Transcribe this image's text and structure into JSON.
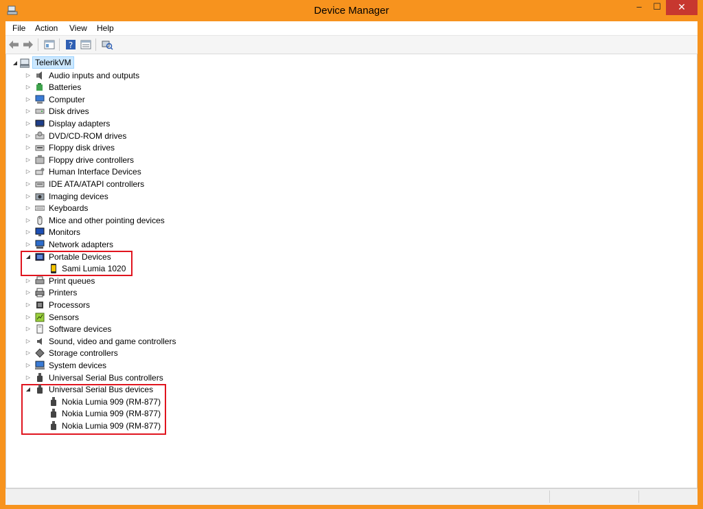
{
  "window": {
    "title": "Device Manager",
    "minimize": "–",
    "maximize": "☐",
    "close": "✕",
    "icon": "device-manager-icon"
  },
  "menu": [
    "File",
    "Action",
    "View",
    "Help"
  ],
  "toolbar": [
    "back-arrow-icon",
    "forward-arrow-icon",
    "show-hide-console-tree-icon",
    "help-icon",
    "properties-icon",
    "scan-hardware-icon"
  ],
  "tree": {
    "root": "TelerikVM",
    "categories": [
      {
        "label": "Audio inputs and outputs",
        "icon": "speaker-icon",
        "expanded": false
      },
      {
        "label": "Batteries",
        "icon": "battery-icon",
        "expanded": false
      },
      {
        "label": "Computer",
        "icon": "computer-icon",
        "expanded": false
      },
      {
        "label": "Disk drives",
        "icon": "disk-drive-icon",
        "expanded": false
      },
      {
        "label": "Display adapters",
        "icon": "display-adapter-icon",
        "expanded": false
      },
      {
        "label": "DVD/CD-ROM drives",
        "icon": "dvd-drive-icon",
        "expanded": false
      },
      {
        "label": "Floppy disk drives",
        "icon": "floppy-disk-icon",
        "expanded": false
      },
      {
        "label": "Floppy drive controllers",
        "icon": "floppy-controller-icon",
        "expanded": false
      },
      {
        "label": "Human Interface Devices",
        "icon": "hid-icon",
        "expanded": false
      },
      {
        "label": "IDE ATA/ATAPI controllers",
        "icon": "ide-controller-icon",
        "expanded": false
      },
      {
        "label": "Imaging devices",
        "icon": "camera-icon",
        "expanded": false
      },
      {
        "label": "Keyboards",
        "icon": "keyboard-icon",
        "expanded": false
      },
      {
        "label": "Mice and other pointing devices",
        "icon": "mouse-icon",
        "expanded": false
      },
      {
        "label": "Monitors",
        "icon": "monitor-icon",
        "expanded": false
      },
      {
        "label": "Network adapters",
        "icon": "network-adapter-icon",
        "expanded": false
      },
      {
        "label": "Portable Devices",
        "icon": "portable-device-icon",
        "expanded": true,
        "children": [
          {
            "label": "Sami Lumia 1020",
            "icon": "phone-icon"
          }
        ]
      },
      {
        "label": "Print queues",
        "icon": "print-queue-icon",
        "expanded": false
      },
      {
        "label": "Printers",
        "icon": "printer-icon",
        "expanded": false
      },
      {
        "label": "Processors",
        "icon": "processor-icon",
        "expanded": false
      },
      {
        "label": "Sensors",
        "icon": "sensor-icon",
        "expanded": false
      },
      {
        "label": "Software devices",
        "icon": "software-device-icon",
        "expanded": false
      },
      {
        "label": "Sound, video and game controllers",
        "icon": "sound-icon",
        "expanded": false
      },
      {
        "label": "Storage controllers",
        "icon": "storage-controller-icon",
        "expanded": false
      },
      {
        "label": "System devices",
        "icon": "system-device-icon",
        "expanded": false
      },
      {
        "label": "Universal Serial Bus controllers",
        "icon": "usb-icon",
        "expanded": false
      },
      {
        "label": "Universal Serial Bus devices",
        "icon": "usb-icon",
        "expanded": true,
        "children": [
          {
            "label": "Nokia Lumia 909 (RM-877)",
            "icon": "usb-icon"
          },
          {
            "label": "Nokia Lumia 909 (RM-877)",
            "icon": "usb-icon"
          },
          {
            "label": "Nokia Lumia 909 (RM-877)",
            "icon": "usb-icon"
          }
        ]
      }
    ]
  },
  "colors": {
    "frame": "#f7931e",
    "close_button": "#c7372f",
    "highlight_box": "#e0141e",
    "root_selection": "#cce8ff"
  }
}
